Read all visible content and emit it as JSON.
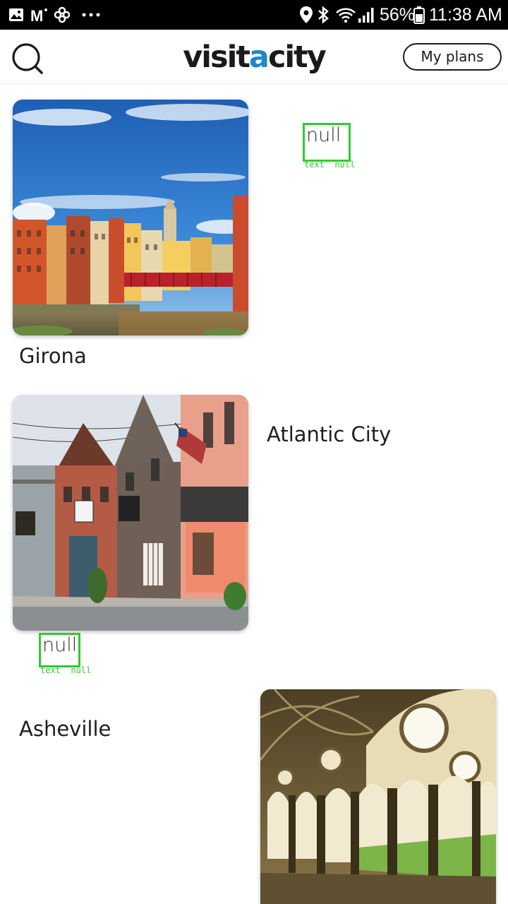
{
  "status_bar": {
    "icons": [
      "gallery-icon",
      "gmail-icon",
      "pinwheel-icon",
      "more-dots-icon",
      "location-icon",
      "bluetooth-icon",
      "wifi-icon",
      "signal-icon",
      "battery-icon"
    ],
    "battery": "56%",
    "time": "11:38 AM"
  },
  "header": {
    "logo_prefix": "visit",
    "logo_accent": "a",
    "logo_suffix": "city",
    "accent_color": "#1e88c9",
    "my_plans": "My plans",
    "search_icon": "search-icon"
  },
  "cities": [
    {
      "name": "Girona",
      "image": "girona-photo"
    },
    {
      "name": "Atlantic City",
      "image": "atlantic-city-photo"
    },
    {
      "name": "Asheville",
      "image": "asheville-photo"
    }
  ],
  "placeholders": [
    {
      "text": "null",
      "caption": "text  null"
    },
    {
      "text": "null",
      "caption": "text  null"
    }
  ],
  "highlight_color": "#2ecc2e"
}
